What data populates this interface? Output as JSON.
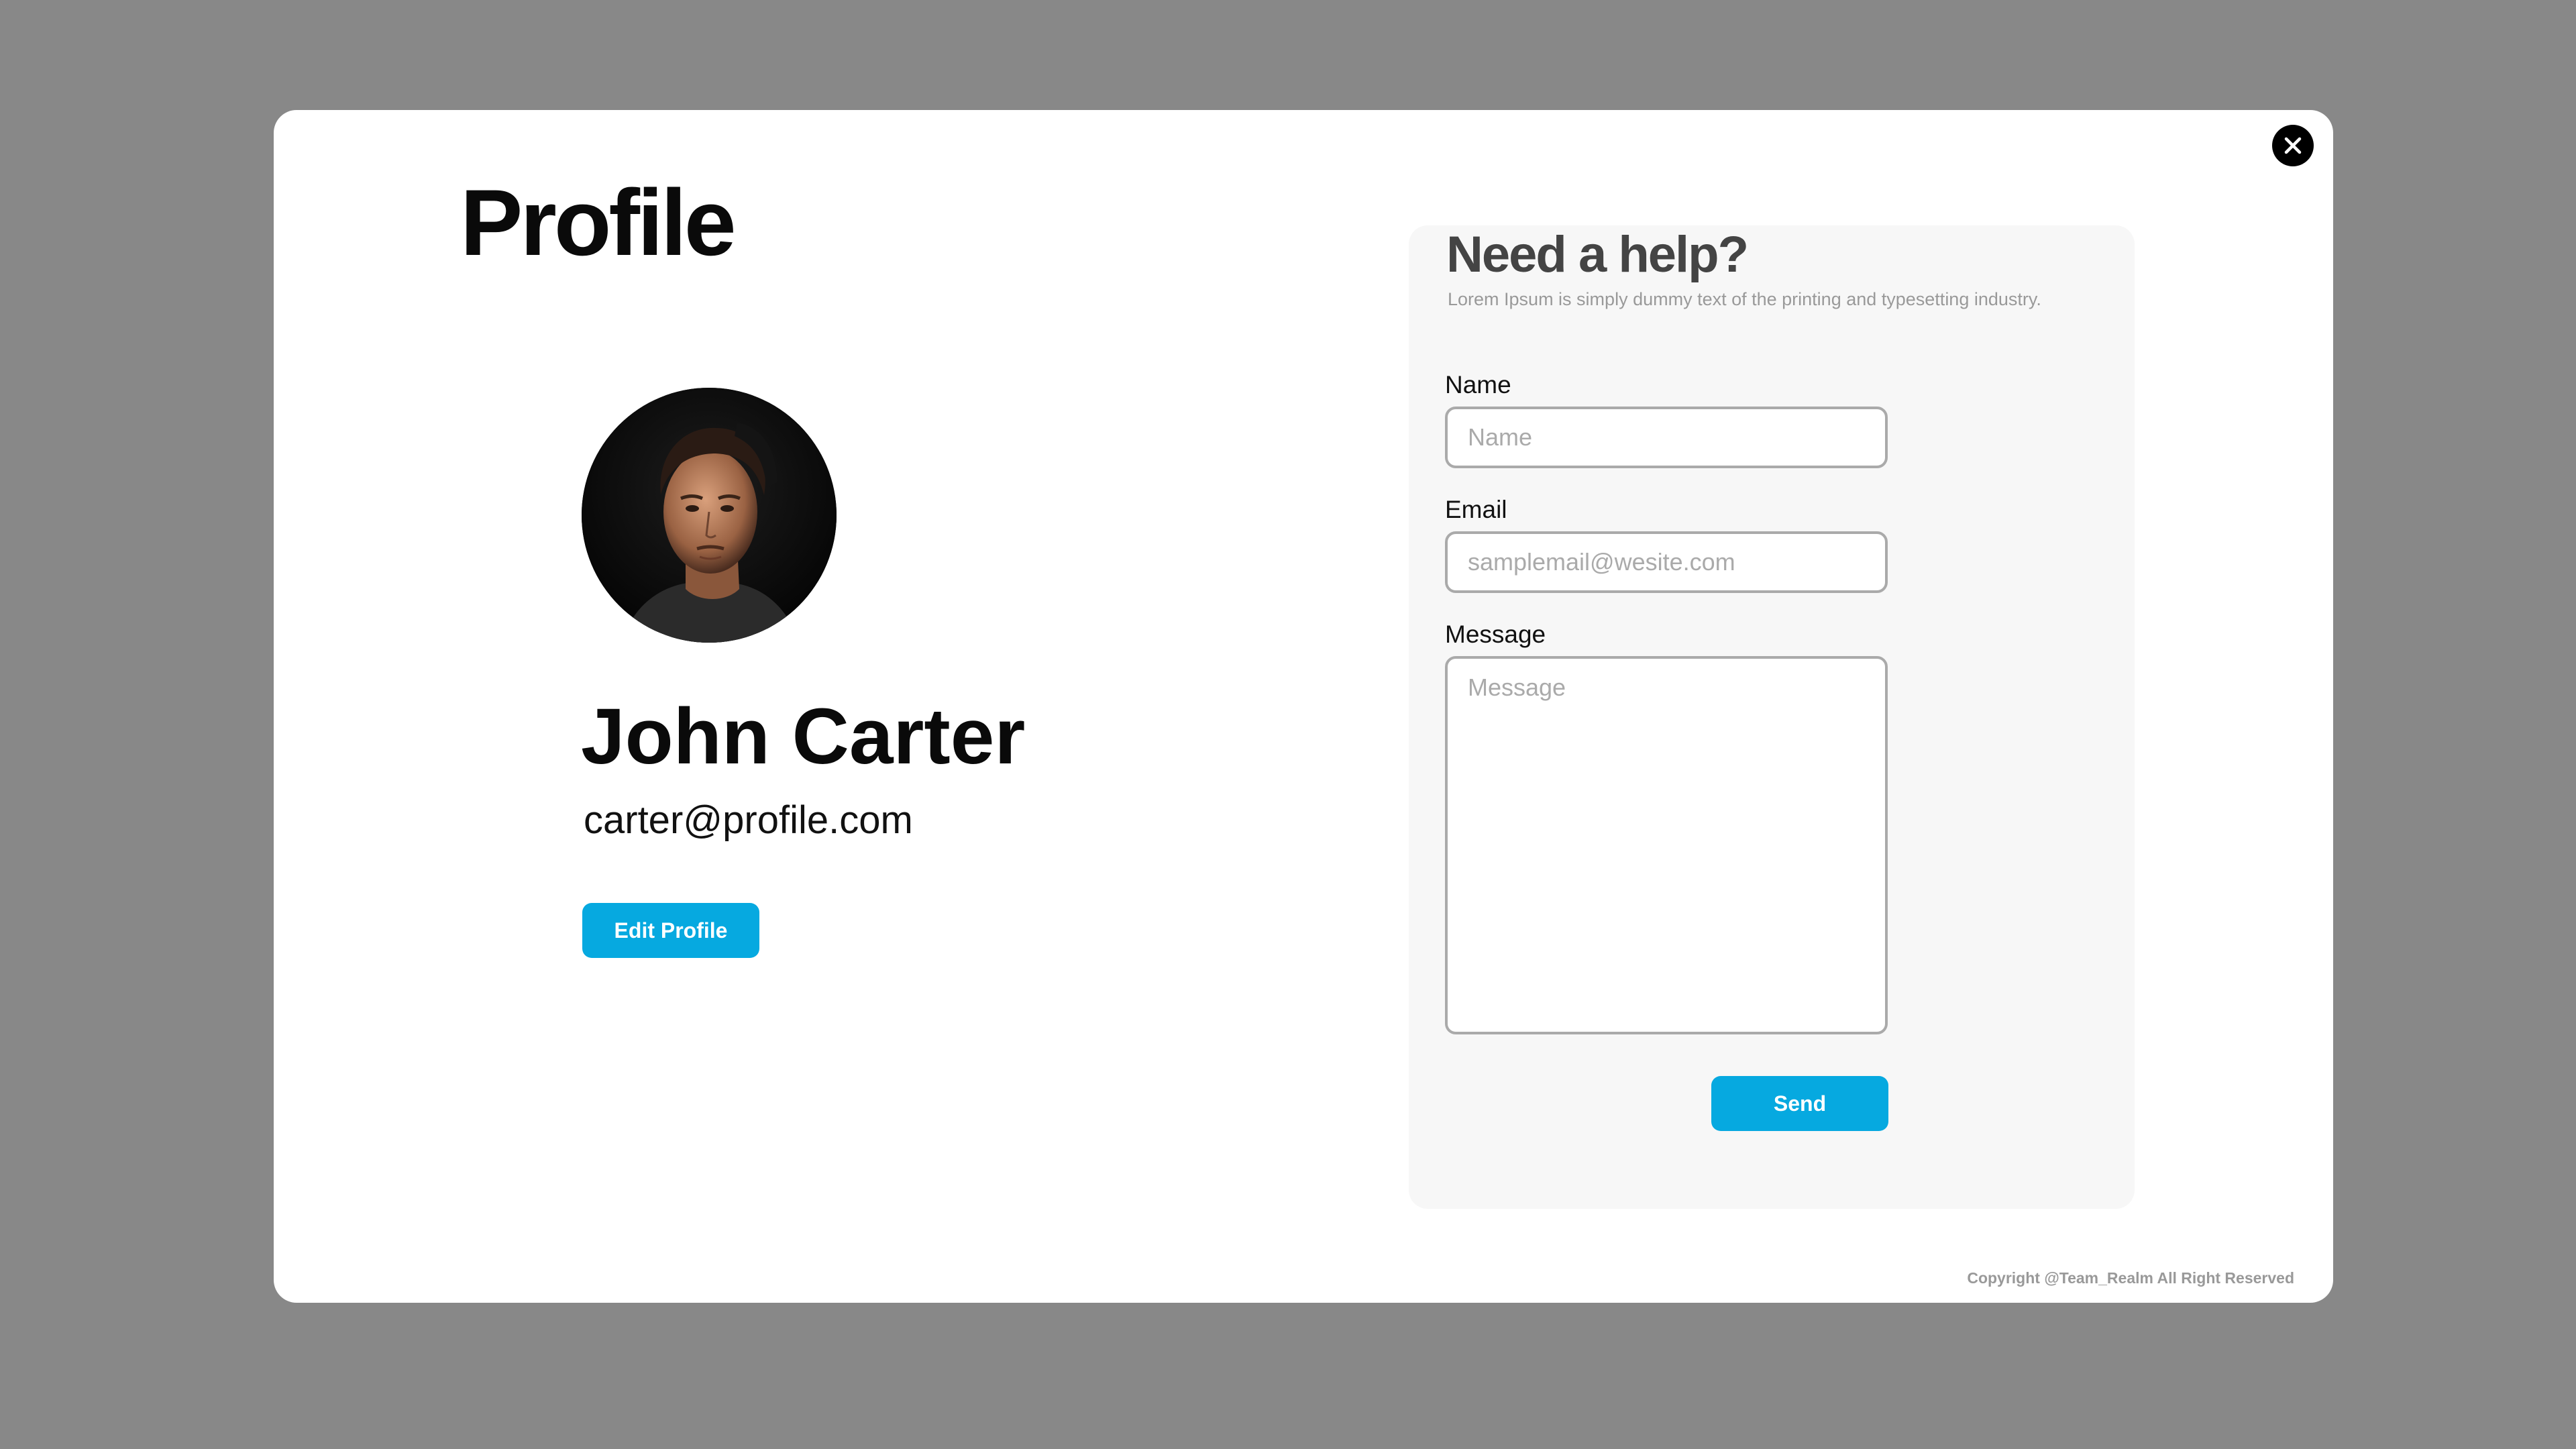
{
  "profile": {
    "title": "Profile",
    "user_name": "John Carter",
    "user_email": "carter@profile.com",
    "edit_button_label": "Edit Profile",
    "avatar_icon": "person-photo"
  },
  "help": {
    "title": "Need a help?",
    "description": "Lorem Ipsum is simply dummy text of the printing and typesetting industry.",
    "name_label": "Name",
    "name_placeholder": "Name",
    "email_label": "Email",
    "email_placeholder": "samplemail@wesite.com",
    "message_label": "Message",
    "message_placeholder": "Message",
    "send_button_label": "Send"
  },
  "close_icon": "close-icon",
  "footer": {
    "copyright": "Copyright @Team_Realm All Right Reserved"
  },
  "colors": {
    "backdrop": "#888888",
    "accent": "#06a9e0",
    "panel": "#f7f7f7"
  }
}
